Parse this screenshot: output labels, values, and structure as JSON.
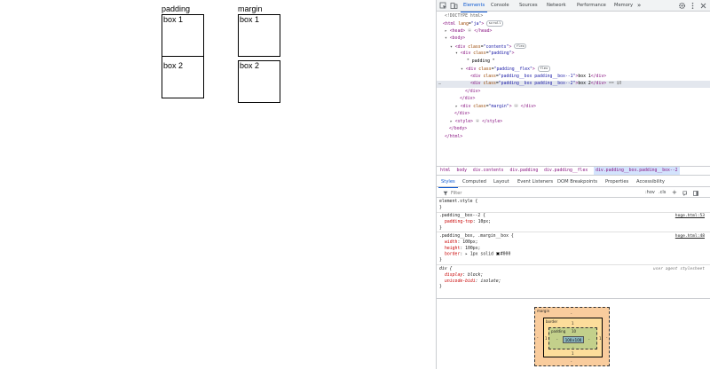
{
  "viewport": {
    "columns": [
      {
        "title": "padding",
        "boxes": [
          "box 1",
          "box 2"
        ]
      },
      {
        "title": "margin",
        "boxes": [
          "box 1",
          "box 2"
        ]
      }
    ]
  },
  "devtools": {
    "toolbar_icons": [
      "inspect-element-icon",
      "device-toolbar-icon",
      "more-tabs-icon",
      "settings-icon",
      "more-options-icon",
      "close-icon"
    ],
    "tabs": [
      "Elements",
      "Console",
      "Sources",
      "Network",
      "Performance",
      "Memory"
    ],
    "more_tabs": "»",
    "active_tab": "Elements",
    "dom": {
      "doctype": "<!DOCTYPE html>",
      "html_open_tag": "html",
      "html_attr": "lang",
      "html_attr_val": "\"ja\"",
      "scroll_badge": "scroll",
      "head": "head",
      "head_close": "</head>",
      "body": "<body>",
      "contents_tag": "div",
      "contents_attr": "class",
      "contents_val": "\"contents\"",
      "flex_badge": "flex",
      "padding_tag": "div",
      "padding_attr": "class",
      "padding_val": "\"padding\"",
      "padding_text": "\" padding \"",
      "pflex_tag": "div",
      "pflex_attr": "class",
      "pflex_val": "\"padding__flex\"",
      "box1_tag": "div",
      "box1_attr": "class",
      "box1_val": "\"padding__box padding__box--1\"",
      "box1_text": "box 1",
      "box2_tag": "div",
      "box2_attr": "class",
      "box2_val": "\"padding__box padding__box--2\"",
      "box2_text": "box 2",
      "sel_marker": "== $0",
      "div_close": "</div>",
      "margin_tag": "div",
      "margin_attr": "class",
      "margin_val": "\"margin\"",
      "style_tag": "style",
      "style_close": "</style>",
      "body_close": "</body>",
      "html_close": "</html>",
      "ellipsis": "…"
    },
    "breadcrumbs": [
      "html",
      "body",
      "div.contents",
      "div.padding",
      "div.padding__flex",
      "div.padding__box.padding__box--2"
    ],
    "styles_tabs": [
      "Styles",
      "Computed",
      "Layout",
      "Event Listeners",
      "DOM Breakpoints",
      "Properties",
      "Accessibility"
    ],
    "active_styles_tab": "Styles",
    "filter_placeholder": "Filter",
    "filter_buttons": [
      ":hov",
      ".cls",
      "+"
    ],
    "rules": {
      "element_style": "element.style {",
      "close": "}",
      "r1_selector": ".padding__box--2 {",
      "r1_source": "hoge.html:53",
      "r1_prop": "padding-top",
      "r1_val": "10px;",
      "r2_selector": ".padding__box, .margin__box {",
      "r2_source": "hoge.html:48",
      "r2_p1": "width",
      "r2_v1": "100px;",
      "r2_p2": "height",
      "r2_v2": "100px;",
      "r2_p3": "border",
      "r2_v3": "▸ 1px solid",
      "r2_v3_color": "#000",
      "r3_selector": "div {",
      "r3_source": "user agent stylesheet",
      "r3_p1": "display",
      "r3_v1": "block;",
      "r3_p2": "unicode-bidi",
      "r3_v2": "isolate;"
    },
    "box_model": {
      "margin_label": "margin",
      "margin_value": "-",
      "border_label": "border",
      "border_value": "1",
      "padding_label": "padding",
      "padding_top": "10",
      "padding_value": "-",
      "content": "100×100",
      "side_left": "-",
      "side_right": "-",
      "side_bottom": "-",
      "border_side": "1",
      "colors": {
        "margin": "#f9cc9d",
        "border": "#fddd9b",
        "padding": "#c3d08b",
        "content": "#8cb6c0"
      }
    }
  }
}
